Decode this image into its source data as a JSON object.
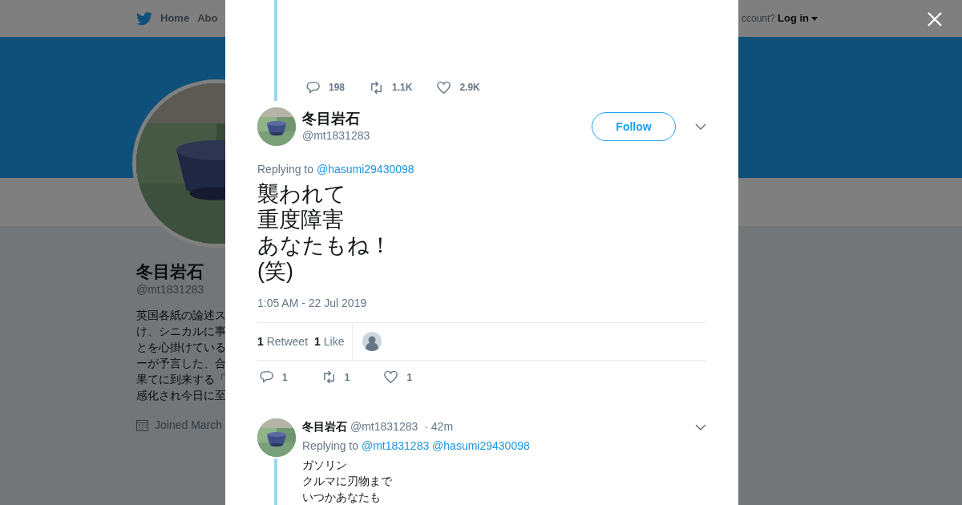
{
  "background": {
    "nav": {
      "home": "Home",
      "about": "Abo",
      "account_prompt": "ccount?",
      "login": "Log in"
    },
    "profile": {
      "name": "冬目岩石",
      "handle": "@mt1831283",
      "bio_lines": [
        "英国各紙の論述ス",
        "け、シニカルに事",
        "とを心掛けている",
        "ーが予言した、合",
        "果てに到来する「",
        "感化され今日に至"
      ],
      "joined": "Joined March"
    }
  },
  "modal": {
    "previous_stats": {
      "replies": "198",
      "retweets": "1.1K",
      "likes": "2.9K"
    },
    "tweet": {
      "name": "冬目岩石",
      "handle": "@mt1831283",
      "follow": "Follow",
      "replying_label": "Replying to",
      "replying_to": [
        "@hasumi29430098"
      ],
      "text_lines": [
        "襲われて",
        "重度障害",
        "あなたもね！",
        "(笑)"
      ],
      "timestamp": "1:05 AM - 22 Jul 2019",
      "retweet_count": "1",
      "retweet_label": "Retweet",
      "like_count": "1",
      "like_label": "Like",
      "replies": "1",
      "retweets": "1",
      "likes": "1"
    },
    "reply": {
      "name": "冬目岩石",
      "handle": "@mt1831283",
      "time": "· 42m",
      "replying_label": "Replying to",
      "replying_to": [
        "@mt1831283",
        "@hasumi29430098"
      ],
      "text_lines": [
        "ガソリン",
        "クルマに刃物まで",
        "いつかあなたも"
      ]
    }
  }
}
